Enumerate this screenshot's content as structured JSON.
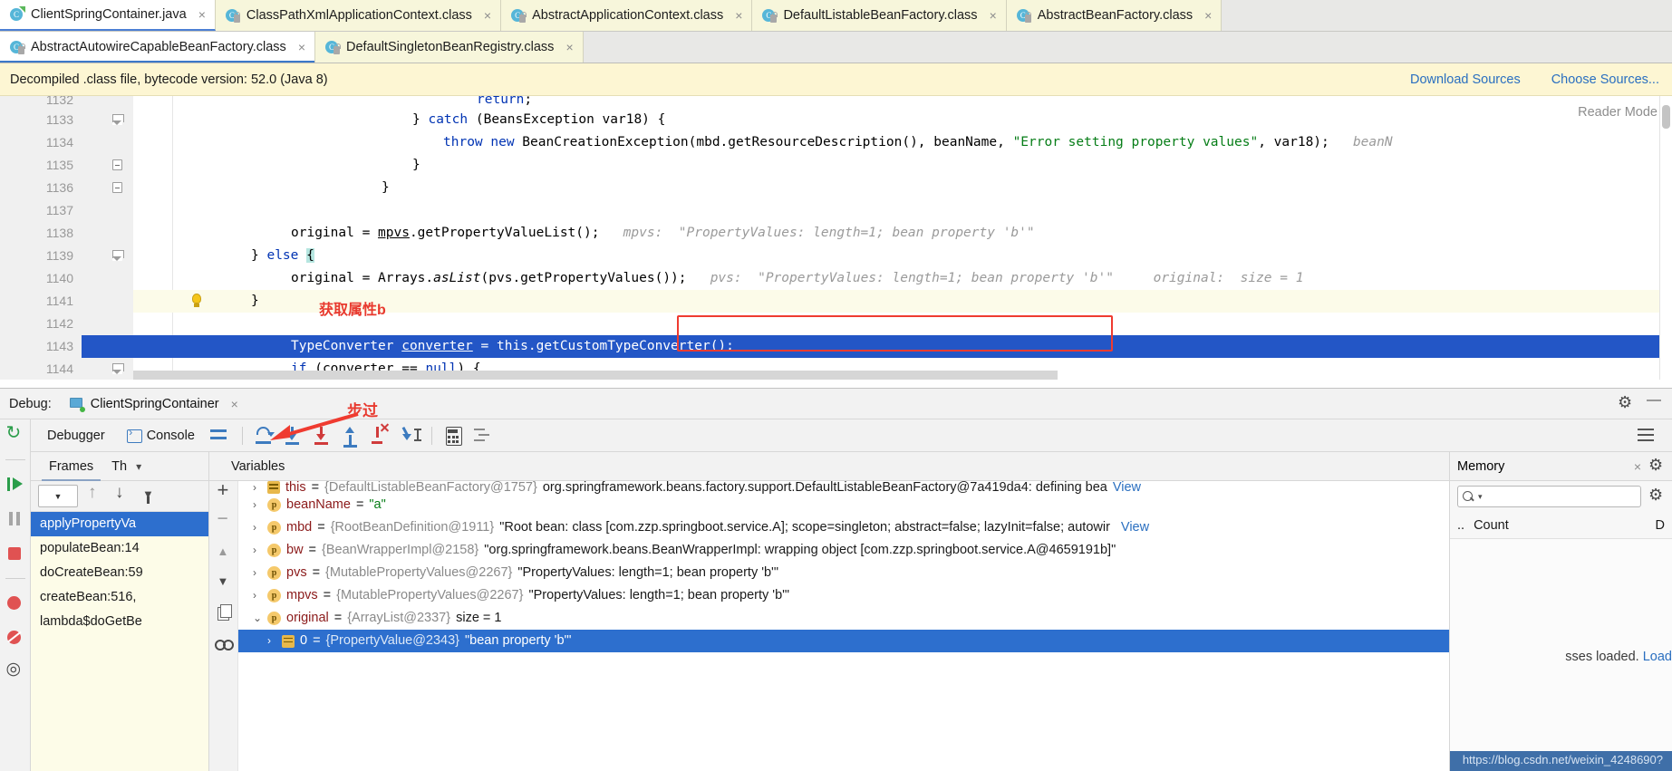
{
  "editor_tabs_row1": [
    {
      "label": "ClientSpringContainer.java",
      "icon": "java-class-icon",
      "active": true,
      "close": "×"
    },
    {
      "label": "ClassPathXmlApplicationContext.class",
      "icon": "compiled-class-icon",
      "active": false,
      "close": "×"
    },
    {
      "label": "AbstractApplicationContext.class",
      "icon": "compiled-class-icon",
      "active": false,
      "close": "×"
    },
    {
      "label": "DefaultListableBeanFactory.class",
      "icon": "compiled-class-icon",
      "active": false,
      "close": "×"
    },
    {
      "label": "AbstractBeanFactory.class",
      "icon": "compiled-class-icon",
      "active": false,
      "close": "×"
    }
  ],
  "editor_tabs_row2": [
    {
      "label": "AbstractAutowireCapableBeanFactory.class",
      "icon": "compiled-class-icon",
      "active": true,
      "close": "×"
    },
    {
      "label": "DefaultSingletonBeanRegistry.class",
      "icon": "compiled-class-icon",
      "active": false,
      "close": "×"
    }
  ],
  "notification": {
    "message": "Decompiled .class file, bytecode version: 52.0 (Java 8)",
    "download_sources": "Download Sources",
    "choose_sources": "Choose Sources..."
  },
  "editor": {
    "reader_mode": "Reader Mode",
    "annotation_red_comment": "获取属性b",
    "lines": [
      {
        "num": "1132",
        "text": "return;",
        "indent": 26,
        "state": "cut"
      },
      {
        "num": "1133",
        "text": "} catch (BeansException var18) {",
        "indent": 20,
        "fold": "collapse"
      },
      {
        "num": "1134",
        "text": "throw new BeanCreationException(mbd.getResourceDescription(), beanName, \"Error setting property values\", var18);",
        "indent": 24,
        "hint": "beanName:"
      },
      {
        "num": "1135",
        "text": "}",
        "indent": 20,
        "fold": "minus"
      },
      {
        "num": "1136",
        "text": "}",
        "indent": 16,
        "fold": "minus"
      },
      {
        "num": "1137",
        "text": "",
        "indent": 0
      },
      {
        "num": "1138",
        "text": "original = mpvs.getPropertyValueList();",
        "indent": 20,
        "hint_name": "mpvs:",
        "hint_value": "\"PropertyValues: length=1; bean property 'b'\""
      },
      {
        "num": "1139",
        "text": "} else {",
        "indent": 12,
        "fold": "collapse"
      },
      {
        "num": "1140",
        "text": "original = Arrays.asList(pvs.getPropertyValues());",
        "indent": 20,
        "hint_name": "pvs:",
        "hint_value": "\"PropertyValues: length=1; bean property 'b'\"",
        "hint_name2": "original:",
        "hint_value2": "size = 1"
      },
      {
        "num": "1141",
        "text": "}",
        "indent": 12,
        "bulb": true
      },
      {
        "num": "1142",
        "text": "",
        "indent": 0
      },
      {
        "num": "1143",
        "text": "TypeConverter converter = this.getCustomTypeConverter();",
        "indent": 16,
        "executing": true
      },
      {
        "num": "1144",
        "text": "if (converter == null) {",
        "indent": 16,
        "fold": "collapse"
      }
    ]
  },
  "debug": {
    "label": "Debug:",
    "session_name": "ClientSpringContainer",
    "session_close": "×",
    "annotation_step_over": "步过",
    "settings_icon": "gear-icon",
    "minimize_icon": "minimize-icon",
    "tabs": [
      {
        "label": "Debugger",
        "active": true
      },
      {
        "label": "Console",
        "active": false
      }
    ],
    "toolbar_buttons": [
      {
        "name": "show-execution-point",
        "icon": "lines-icon"
      },
      {
        "name": "step-over",
        "icon": "step-over-icon"
      },
      {
        "name": "step-into",
        "icon": "step-into-icon"
      },
      {
        "name": "force-step-into",
        "icon": "force-step-into-icon"
      },
      {
        "name": "step-out",
        "icon": "step-out-icon"
      },
      {
        "name": "drop-frame",
        "icon": "drop-frame-icon"
      },
      {
        "name": "run-to-cursor",
        "icon": "run-to-cursor-icon"
      },
      {
        "name": "evaluate-expression",
        "icon": "calculator-icon"
      },
      {
        "name": "layout-settings",
        "icon": "settings-lines-icon"
      }
    ],
    "frames_pane": {
      "tab_frames": "Frames",
      "tab_threads": "Th",
      "items": [
        {
          "label": "applyPropertyVa",
          "selected": true
        },
        {
          "label": "populateBean:14",
          "selected": false
        },
        {
          "label": "doCreateBean:59",
          "selected": false
        },
        {
          "label": "createBean:516,",
          "selected": false
        },
        {
          "label": "lambda$doGetBe",
          "selected": false
        }
      ]
    },
    "variables_pane": {
      "title": "Variables",
      "rows": [
        {
          "expander": "›",
          "badge": "field",
          "name": "this",
          "eq": " = ",
          "ref": "{DefaultListableBeanFactory@1757}",
          "value": "org.springframework.beans.factory.support.DefaultListableBeanFactory@7a419da4: defining bea",
          "link": "View",
          "partial": true
        },
        {
          "expander": "›",
          "badge": "p",
          "name": "beanName",
          "eq": " = ",
          "ref": "",
          "value": "\"a\"",
          "value_is_string": true
        },
        {
          "expander": "›",
          "badge": "p",
          "name": "mbd",
          "eq": " = ",
          "ref": "{RootBeanDefinition@1911}",
          "value": "\"Root bean: class [com.zzp.springboot.service.A]; scope=singleton; abstract=false; lazyInit=false; autowir",
          "link": "View"
        },
        {
          "expander": "›",
          "badge": "p",
          "name": "bw",
          "eq": " = ",
          "ref": "{BeanWrapperImpl@2158}",
          "value": "\"org.springframework.beans.BeanWrapperImpl: wrapping object [com.zzp.springboot.service.A@4659191b]\""
        },
        {
          "expander": "›",
          "badge": "p",
          "name": "pvs",
          "eq": " = ",
          "ref": "{MutablePropertyValues@2267}",
          "value": "\"PropertyValues: length=1; bean property 'b'\""
        },
        {
          "expander": "›",
          "badge": "p",
          "name": "mpvs",
          "eq": " = ",
          "ref": "{MutablePropertyValues@2267}",
          "value": "\"PropertyValues: length=1; bean property 'b'\""
        },
        {
          "expander": "⌄",
          "badge": "p",
          "name": "original",
          "eq": " = ",
          "ref": "{ArrayList@2337}",
          "value": "size = 1"
        },
        {
          "expander": "›",
          "badge": "list",
          "name": "0",
          "eq": " = ",
          "ref": "{PropertyValue@2343}",
          "value": "\"bean property 'b'\"",
          "selected": true
        }
      ]
    },
    "memory_pane": {
      "title": "Memory",
      "close": "×",
      "search_placeholder": "",
      "col_count": "Count",
      "col_diff": "D",
      "note_text": "sses loaded.",
      "note_link": "Load"
    }
  },
  "watermark": "https://blog.csdn.net/weixin_4248690?",
  "colors": {
    "accent_blue": "#2356c6",
    "selection_blue": "#2d6fce",
    "annotation_red": "#ef3b30",
    "notify_yellow": "#fdf6d3",
    "tab_yellow": "#f7f6db",
    "string_green": "#067d17",
    "keyword_blue": "#0033b3"
  }
}
